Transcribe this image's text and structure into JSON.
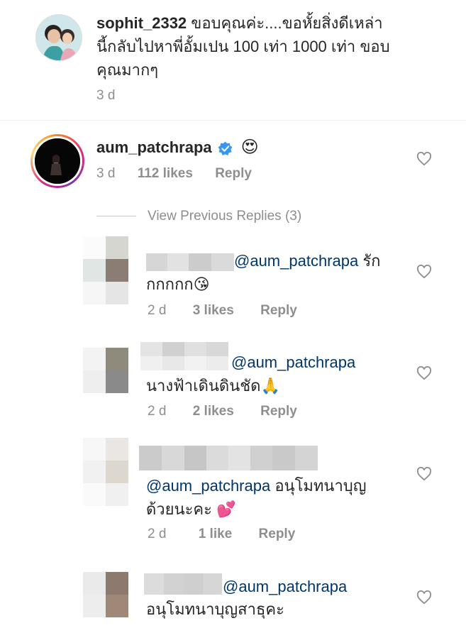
{
  "top_comment": {
    "username": "sophit_2332",
    "line1": " ขอบคุณค่ะ....ขอหั้ยสิ่งดีเหล่า",
    "line2": "นี้กลับไปหาพี่อั้มเปน 100 เท่า 1000 เท่า ขอบ",
    "line3": "คุณมากๆ",
    "time": "3 d"
  },
  "main_comment": {
    "username": "aum_patchrapa",
    "emoji": "😍",
    "time": "3 d",
    "likes": "112 likes",
    "reply": "Reply"
  },
  "view_previous": "View Previous Replies (3)",
  "replies": [
    {
      "mention": "@aum_patchrapa",
      "text_inline": " รัก",
      "text_line2": "กกกกก",
      "emoji": "😘",
      "time": "2 d",
      "likes": "3 likes",
      "reply": "Reply"
    },
    {
      "mention": "@aum_patchrapa",
      "text_line2": "นางฟ้าเดินดินชัด",
      "emoji": "🙏",
      "time": "2 d",
      "likes": "2 likes",
      "reply": "Reply"
    },
    {
      "mention": "@aum_patchrapa",
      "text_inline": " อนุโมทนาบุญ",
      "text_line2": "ด้วยนะคะ",
      "emoji": "💕",
      "time": "2 d",
      "likes": "1 like",
      "reply": "Reply"
    },
    {
      "mention": "@aum_patchrapa",
      "text_line2": "อนุโมทนาบุญสาธุคะ"
    }
  ],
  "colors": {
    "text": "#262626",
    "meta": "#8e8e8e",
    "mention": "#00376b",
    "verified": "#3897f0",
    "divider": "#dbdbdb"
  }
}
